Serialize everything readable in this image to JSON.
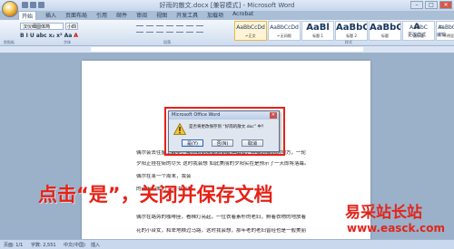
{
  "titlebar": {
    "title": "好雨的散文.docx [兼容模式] - Microsoft Word",
    "minimize": "–",
    "maximize": "□",
    "close": "✕"
  },
  "tabs": [
    "开始",
    "插入",
    "页面布局",
    "引用",
    "邮件",
    "审阅",
    "视图",
    "开发工具",
    "加载项",
    "Acrobat"
  ],
  "ribbon": {
    "font_name": "汉仪细圆体简",
    "font_size": "小四",
    "format_buttons": [
      "B",
      "I",
      "U",
      "abc",
      "x₂",
      "x²",
      "Aa",
      "A"
    ],
    "styles": [
      {
        "sample": "AaBbCcDd",
        "name": "↵正文",
        "big": false,
        "selected": true
      },
      {
        "sample": "AaBbCcDd",
        "name": "↵无间隔",
        "big": false,
        "selected": false
      },
      {
        "sample": "AaBl",
        "name": "标题 1",
        "big": true,
        "selected": false
      },
      {
        "sample": "AaBbC",
        "name": "标题 2",
        "big": true,
        "selected": false
      },
      {
        "sample": "AaBbC",
        "name": "标题",
        "big": true,
        "selected": false
      },
      {
        "sample": "AaBbC",
        "name": "副标题",
        "big": false,
        "selected": false
      },
      {
        "sample": "AaBbCcDd",
        "name": "不明显强调",
        "big": false,
        "selected": false
      }
    ],
    "change_styles": "更改样式",
    "editing": "编辑",
    "group_labels": {
      "clipboard": "剪贴板",
      "font": "字体",
      "paragraph": "段落",
      "styles": "样式"
    }
  },
  "document": {
    "paragraphs": [
      "偶尔会去往屋上散步，那然看到从街道到延伸出去，在极远极远的地方，一轮",
      "夕阳正挂在街的尽头 这时我会想 如此美丽的夕阳实在是预示了一天即将落幕。",
      "偶尔在某一个周末，我会",
      "的带来的爱的 这时我会想",
      "偶尔在路旁的咖啡座，看梯灯亮起，一位衣着素朴的老妇，孵着衣物的地放着",
      "花的小台女，和卑地横过马路，这时我会想，那年老的老妇曾经也是一般美丽"
    ]
  },
  "dialog": {
    "title": "Microsoft Office Word",
    "message": "是否将更改保存到 “好雨的散文.doc” 中？",
    "buttons": [
      "是(Y)",
      "否(N)",
      "取消"
    ]
  },
  "annotation": {
    "instruction": "点击“是”，关闭并保存文档",
    "color": "#e62116"
  },
  "statusbar": {
    "page": "页面: 1/1",
    "words": "字数: 2,551",
    "language": "中文(中国)",
    "mode": "插入"
  },
  "watermark": {
    "cn": "易采站长站",
    "en": "www.easck.com"
  }
}
